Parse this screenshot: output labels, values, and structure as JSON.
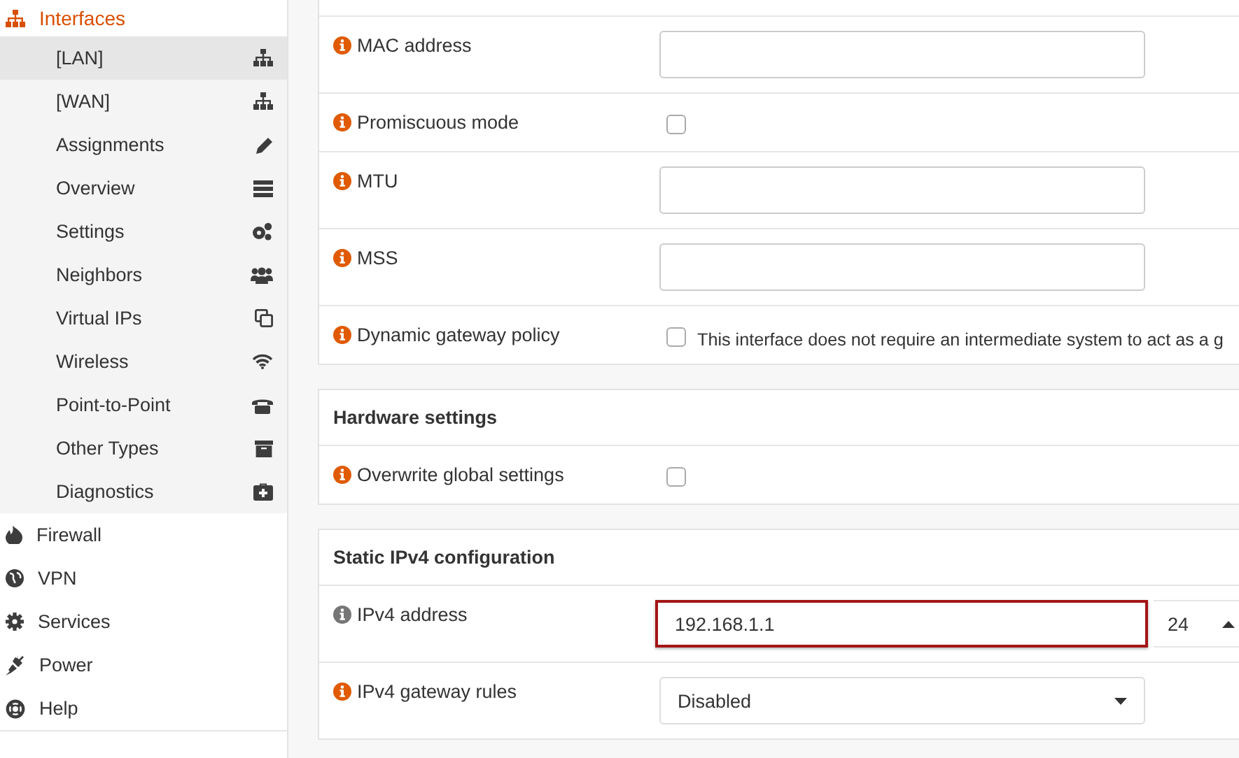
{
  "sidebar": {
    "section": {
      "label": "Interfaces"
    },
    "items": [
      {
        "label": "[LAN]",
        "selected": true
      },
      {
        "label": "[WAN]",
        "selected": false
      },
      {
        "label": "Assignments",
        "selected": false
      },
      {
        "label": "Overview",
        "selected": false
      },
      {
        "label": "Settings",
        "selected": false
      },
      {
        "label": "Neighbors",
        "selected": false
      },
      {
        "label": "Virtual IPs",
        "selected": false
      },
      {
        "label": "Wireless",
        "selected": false
      },
      {
        "label": "Point-to-Point",
        "selected": false
      },
      {
        "label": "Other Types",
        "selected": false
      },
      {
        "label": "Diagnostics",
        "selected": false
      }
    ],
    "menu": [
      "Firewall",
      "VPN",
      "Services",
      "Power",
      "Help"
    ]
  },
  "panels": [
    {
      "rows": [
        {
          "kind": "text",
          "label": "MAC address",
          "color": "#e05a00",
          "value": ""
        },
        {
          "kind": "checkbox",
          "label": "Promiscuous mode",
          "color": "#e05a00",
          "checked": false
        },
        {
          "kind": "text",
          "label": "MTU",
          "color": "#e05a00",
          "value": ""
        },
        {
          "kind": "text",
          "label": "MSS",
          "color": "#e05a00",
          "value": ""
        },
        {
          "kind": "checkbox",
          "label": "Dynamic gateway policy",
          "color": "#e05a00",
          "checked": false,
          "text": "This interface does not require an intermediate system to act as a g"
        }
      ]
    },
    {
      "title": "Hardware settings",
      "rows": [
        {
          "kind": "checkbox",
          "label": "Overwrite global settings",
          "color": "#e05a00",
          "checked": false
        }
      ]
    },
    {
      "title": "Static IPv4 configuration",
      "rows": [
        {
          "kind": "cidr",
          "label": "IPv4 address",
          "color": "#767676",
          "value": "192.168.1.1",
          "highlighted": true,
          "prefix": "24"
        },
        {
          "kind": "select",
          "label": "IPv4 gateway rules",
          "color": "#e05a00",
          "value": "Disabled"
        }
      ]
    }
  ]
}
